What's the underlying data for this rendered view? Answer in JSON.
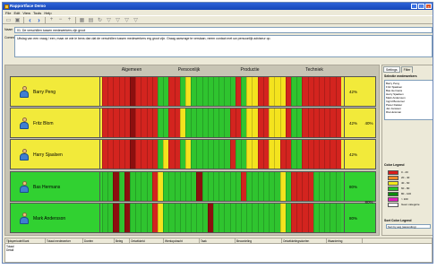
{
  "window": {
    "title": "Rapportface Demo"
  },
  "menu": [
    "File",
    "Edit",
    "View",
    "Tools",
    "Help"
  ],
  "fields": {
    "name_label": "Naam",
    "name_value": "01. De verschillen tussen medewerkers zijn groot",
    "comment_label": "Commentaar",
    "comment_value": "Uitslag van een vraag / een, maar ze wie ie bens dan dat de verschillen tussen medewerkers erg groot zijn. Graag aanvrage te verslaan, neem contact met uw persoonlijk adviseur op."
  },
  "categories": [
    "Algemeen",
    "Persoonlijk",
    "Productie",
    "Techniek"
  ],
  "persons": [
    {
      "name": "Barry Peng",
      "pct": "42%",
      "group": "yellow",
      "cells": "RRRRRDRRRRGGRRGYGGGGGGGGRGYYRRYYYRGGRRRRRRR"
    },
    {
      "name": "Fritz Blom",
      "pct": "42%",
      "group": "yellow",
      "cells": "RRRRRDRRRRGGRRYGGGGGGGGRRGYYRRYYYRGGRRRRRRR"
    },
    {
      "name": "Harry Sjaalsen",
      "pct": "42%",
      "group": "yellow",
      "cells": "RRRRRDRRRRGYRRGYGGGGGGGRGGYYRRYYRRGGRRRRRRR"
    },
    {
      "name": "Bas Hermans",
      "pct": "80%",
      "group": "green",
      "cells": "GGDGDGGGGRYGGGGGGDGGGGGGGRGGGGGGYGRRRRGGGGG"
    },
    {
      "name": "Mark Andersson",
      "pct": "80%",
      "group": "green",
      "cells": "GGDGDGGGGRYGGGGGGGGDGGGGGGGGGGGGYGRRRRGGGGG"
    }
  ],
  "group_pcts": [
    {
      "label": "40%",
      "group": "yellow"
    },
    {
      "label": "80%",
      "group": "green"
    }
  ],
  "bottom": {
    "headers": [
      "Tijdsperiode/Klant",
      "Totaal medewerker",
      "Doelen",
      "Beleg",
      "Ontwikkeld",
      "Werkopdracht",
      "Taak",
      "Beoordeling",
      "Ontwikkelingsdoelen",
      "Waardering"
    ],
    "rows": [
      "Totaal",
      "Detail"
    ]
  },
  "side": {
    "tabs": [
      "Settings",
      "Filter"
    ],
    "section_title": "Selectie medewerkers",
    "list": [
      "Barry Peng",
      "Fritz Sjaalsen",
      "Bas Hermans",
      "Harry Sjaalsen",
      "Mark Andersson",
      "Ingrid Bouwmer",
      "Pieter Dekker",
      "Jan Janssen",
      "Ria Huisman"
    ],
    "legend_title": "Color Legend",
    "legend": [
      {
        "label": "0 - 20",
        "color": "#d91c1c"
      },
      {
        "label": "20 - 40",
        "color": "#f08a2a"
      },
      {
        "label": "40 - 60",
        "color": "#f4e81c"
      },
      {
        "label": "60 - 80",
        "color": "#27c427"
      },
      {
        "label": "80 - 100",
        "color": "#0d8a0d"
      },
      {
        "label": "> 100",
        "color": "#e41bbf"
      },
      {
        "label": "Geen categorie",
        "color": "#ffffff"
      }
    ],
    "sort_title": "Sort Color Legend",
    "sort_value": "Sort by avg (ascending)"
  },
  "colors": {
    "R": "#d3241f",
    "D": "#8c0f0f",
    "G": "#2fc42f",
    "Y": "#f4e31e",
    "yellow_bg": "#f2ea3a",
    "green_bg": "#31d131"
  }
}
